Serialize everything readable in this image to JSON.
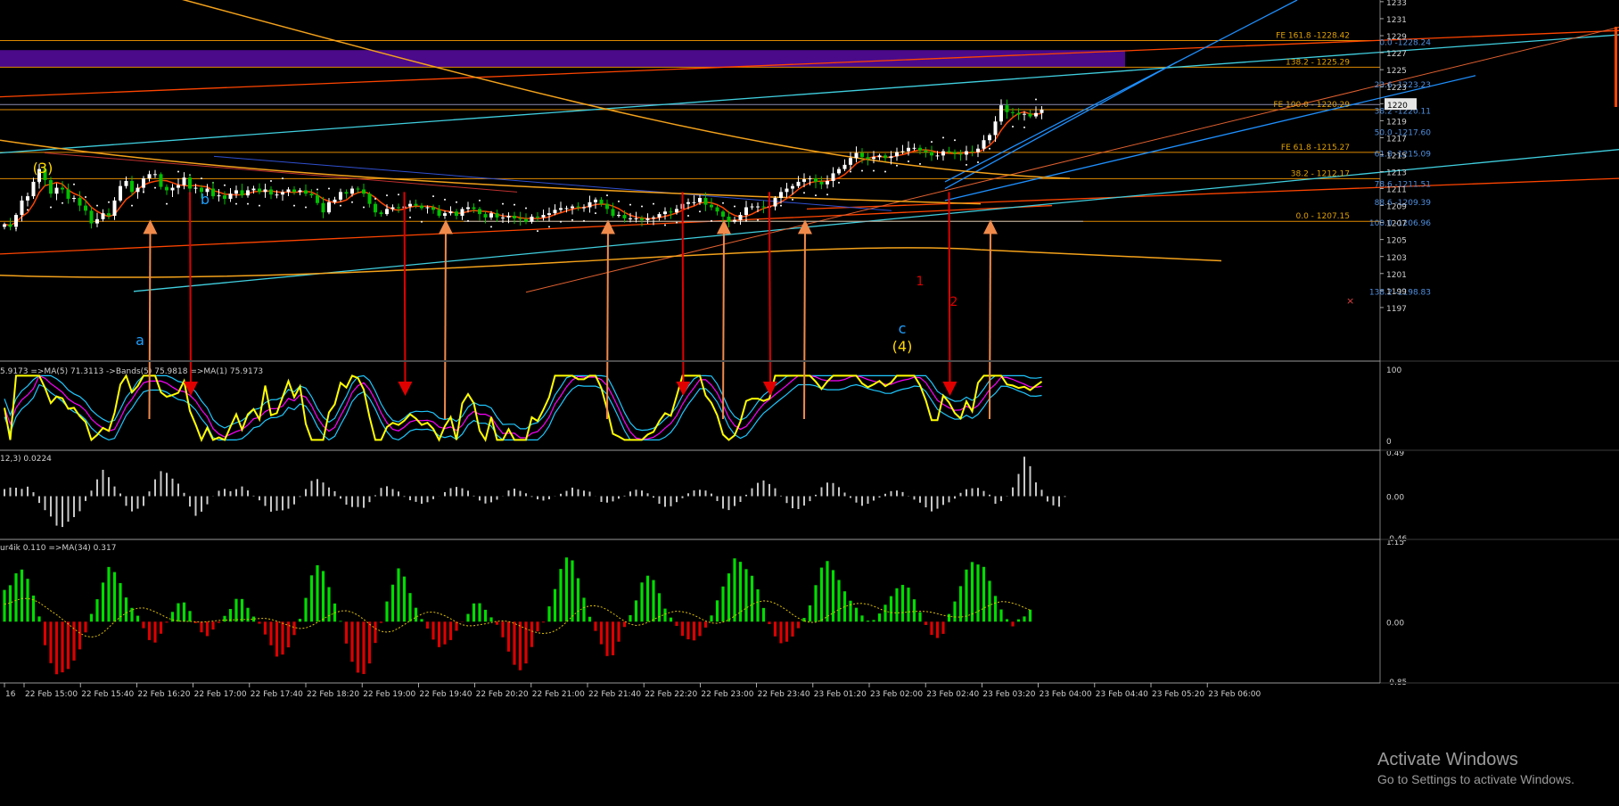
{
  "colors": {
    "background": "#000000",
    "pane_border": "#9a9a9a",
    "axis_text": "#cfcfcf",
    "candle_bull": "#ffffff",
    "candle_bear": "#00c000",
    "ma_fast": "#ff4500",
    "ma_slow": "#f4a21a",
    "psar": "#ffffff",
    "fib_line": "#e08a00",
    "fib_text": "#e0a000",
    "retrace_text": "#4f8fe0",
    "trend_blue": "#1e90ff",
    "trend_cyan": "#40d0e0",
    "trend_orange": "#ff4500",
    "zone": "#4b0a8a",
    "arrow_up": "#f08a4b",
    "arrow_down": "#e00000",
    "stoch_main": "#ffff00",
    "stoch_ma": "#ff00ff",
    "stoch_bands": "#1ec8ff",
    "osc_bar": "#c8c8c8",
    "hist_pos": "#00dd00",
    "hist_neg": "#dd0000",
    "hist_ma": "#e0c000"
  },
  "chart_data": {
    "type": "candlestick",
    "price_axis": {
      "range": [
        1190.8,
        1233.2
      ],
      "tick_labels": [
        "1233",
        "1231",
        "1229",
        "1227",
        "1225",
        "1223",
        "1221",
        "1219",
        "1217",
        "1215",
        "1213",
        "1211",
        "1209",
        "1207",
        "1205",
        "1203",
        "1201",
        "1199",
        "1197"
      ],
      "current_price_label": "1220"
    },
    "time_labels": [
      "16",
      "22 Feb 15:00",
      "22 Feb 15:40",
      "22 Feb 16:20",
      "22 Feb 17:00",
      "22 Feb 17:40",
      "22 Feb 18:20",
      "22 Feb 19:00",
      "22 Feb 19:40",
      "22 Feb 20:20",
      "22 Feb 21:00",
      "22 Feb 21:40",
      "22 Feb 22:20",
      "22 Feb 23:00",
      "22 Feb 23:40",
      "23 Feb 01:20",
      "23 Feb 02:00",
      "23 Feb 02:40",
      "23 Feb 03:20",
      "23 Feb 04:00",
      "23 Feb 04:40",
      "23 Feb 05:20",
      "23 Feb 06:00"
    ],
    "close": [
      1206.8,
      1206.5,
      1207.9,
      1209.6,
      1210.1,
      1211.8,
      1213.3,
      1212.0,
      1210.4,
      1211.1,
      1210.9,
      1209.8,
      1209.9,
      1209.0,
      1208.4,
      1206.9,
      1207.4,
      1208.1,
      1207.8,
      1209.6,
      1211.3,
      1211.9,
      1210.6,
      1211.1,
      1212.2,
      1212.7,
      1212.7,
      1211.2,
      1210.8,
      1211.1,
      1211.4,
      1212.3,
      1211.0,
      1211.1,
      1210.6,
      1211.0,
      1210.1,
      1210.2,
      1209.8,
      1210.4,
      1210.8,
      1210.2,
      1210.8,
      1211.0,
      1210.6,
      1210.9,
      1210.3,
      1210.3,
      1210.6,
      1210.9,
      1210.6,
      1210.8,
      1210.4,
      1210.2,
      1209.3,
      1208.2,
      1209.4,
      1209.7,
      1210.6,
      1210.4,
      1211.0,
      1210.9,
      1210.4,
      1209.2,
      1208.2,
      1208.0,
      1208.6,
      1208.8,
      1208.7,
      1208.9,
      1209.2,
      1209.0,
      1208.7,
      1208.8,
      1208.5,
      1207.8,
      1208.1,
      1208.3,
      1207.8,
      1208.6,
      1208.8,
      1208.6,
      1208.0,
      1207.6,
      1208.1,
      1207.6,
      1207.6,
      1207.8,
      1207.5,
      1207.4,
      1207.1,
      1207.7,
      1207.6,
      1207.9,
      1208.1,
      1208.5,
      1208.7,
      1208.7,
      1208.9,
      1208.8,
      1208.8,
      1209.4,
      1209.7,
      1209.2,
      1208.6,
      1207.8,
      1207.9,
      1207.5,
      1207.5,
      1207.5,
      1207.3,
      1207.5,
      1207.6,
      1208.0,
      1208.3,
      1208.2,
      1208.6,
      1209.2,
      1209.4,
      1209.4,
      1209.9,
      1209.1,
      1208.8,
      1208.3,
      1207.7,
      1207.1,
      1207.3,
      1207.9,
      1208.8,
      1208.9,
      1208.9,
      1208.8,
      1208.9,
      1209.9,
      1210.6,
      1211.0,
      1211.3,
      1211.8,
      1212.1,
      1212.2,
      1211.8,
      1211.5,
      1211.9,
      1212.8,
      1213.3,
      1213.8,
      1214.6,
      1215.2,
      1214.7,
      1214.5,
      1214.7,
      1214.9,
      1214.6,
      1214.8,
      1215.3,
      1215.4,
      1215.8,
      1215.8,
      1215.5,
      1215.3,
      1214.9,
      1214.9,
      1215.4,
      1215.3,
      1215.1,
      1215.0,
      1215.4,
      1215.3,
      1215.7,
      1216.7,
      1217.3,
      1218.9,
      1220.8,
      1220.0,
      1219.9,
      1219.7,
      1219.8,
      1219.5,
      1219.9,
      1220.3
    ],
    "fib_levels": [
      {
        "label": "FE 161.8 -1228.42",
        "price": 1228.42
      },
      {
        "label": "138.2 - 1225.29",
        "price": 1225.29
      },
      {
        "label": "FE 100.0 - 1220.29",
        "price": 1220.29
      },
      {
        "label": "FE 61.8 -1215.27",
        "price": 1215.27
      },
      {
        "label": "38.2 - 1212.17",
        "price": 1212.17
      },
      {
        "label": "0.0 - 1207.15",
        "price": 1207.15
      }
    ],
    "retracements": [
      {
        "label": "0.0 -1228.24",
        "price": 1228.24
      },
      {
        "label": "23.6 -1223.23",
        "price": 1223.23
      },
      {
        "label": "38.2 -1220.11",
        "price": 1220.11
      },
      {
        "label": "50.0 -1217.60",
        "price": 1217.6
      },
      {
        "label": "61.8 -1215.09",
        "price": 1215.09
      },
      {
        "label": "78.6 -1211.51",
        "price": 1211.51
      },
      {
        "label": "88.6 -1209.39",
        "price": 1209.39
      },
      {
        "label": "100.0 -1206.96",
        "price": 1206.96
      },
      {
        "label": "138.2 -1198.83",
        "price": 1198.83
      }
    ],
    "wave_labels": [
      "(3)",
      "b",
      "a",
      "c",
      "(4)",
      "1",
      "2"
    ],
    "stochastic": {
      "header": "5.9173 =>MA(5) 71.3113 ->Bands(5) 75.9818 =>MA(1) 75.9173",
      "tick_labels": [
        "100",
        "0"
      ],
      "range": [
        0,
        100
      ]
    },
    "oscillator": {
      "header": "12,3) 0.0224",
      "tick_labels": [
        "0.49",
        "0.00",
        "-0.46"
      ],
      "range": [
        -0.46,
        0.49
      ],
      "values": [
        0.079,
        0.096,
        0.094,
        0.081,
        0.106,
        0.044,
        -0.075,
        -0.155,
        -0.226,
        -0.327,
        -0.342,
        -0.283,
        -0.232,
        -0.167,
        -0.053,
        0.062,
        0.187,
        0.293,
        0.211,
        0.108,
        0.03,
        -0.107,
        -0.169,
        -0.139,
        -0.108,
        0.053,
        0.187,
        0.278,
        0.259,
        0.195,
        0.139,
        0.037,
        -0.115,
        -0.218,
        -0.172,
        -0.09,
        -0.002,
        0.06,
        0.081,
        0.055,
        0.078,
        0.108,
        0.064,
        0.006,
        -0.046,
        -0.108,
        -0.172,
        -0.161,
        -0.157,
        -0.139,
        -0.091,
        -0.008,
        0.079,
        0.17,
        0.19,
        0.152,
        0.097,
        0.055,
        -0.027,
        -0.094,
        -0.12,
        -0.12,
        -0.129,
        -0.066,
        0.01,
        0.092,
        0.11,
        0.079,
        0.052,
        -0.007,
        -0.045,
        -0.063,
        -0.084,
        -0.067,
        -0.033,
        -0.001,
        0.045,
        0.089,
        0.103,
        0.088,
        0.061,
        0.006,
        -0.048,
        -0.081,
        -0.068,
        -0.039,
        0.002,
        0.063,
        0.084,
        0.059,
        0.032,
        -0.008,
        -0.035,
        -0.049,
        -0.034,
        -0.002,
        0.027,
        0.059,
        0.095,
        0.077,
        0.062,
        0.05,
        0.001,
        -0.064,
        -0.071,
        -0.058,
        -0.028,
        0.006,
        0.052,
        0.072,
        0.063,
        0.032,
        -0.016,
        -0.084,
        -0.118,
        -0.112,
        -0.066,
        -0.022,
        0.032,
        0.064,
        0.071,
        0.063,
        0.029,
        -0.054,
        -0.138,
        -0.154,
        -0.109,
        -0.064,
        0.016,
        0.088,
        0.148,
        0.175,
        0.135,
        0.088,
        0.006,
        -0.076,
        -0.134,
        -0.143,
        -0.104,
        -0.055,
        0.016,
        0.099,
        0.151,
        0.146,
        0.1,
        0.04,
        -0.019,
        -0.071,
        -0.107,
        -0.084,
        -0.049,
        -0.015,
        0.027,
        0.056,
        0.063,
        0.046,
        0.003,
        -0.038,
        -0.072,
        -0.124,
        -0.169,
        -0.139,
        -0.097,
        -0.068,
        -0.027,
        0.037,
        0.077,
        0.088,
        0.092,
        0.058,
        0.017,
        -0.084,
        -0.055,
        -0.003,
        0.098,
        0.247,
        0.438,
        0.333,
        0.153,
        0.071,
        -0.059,
        -0.102,
        -0.117,
        -0.008
      ]
    },
    "histogram": {
      "header": "ur4ik 0.110 =>MA(34) 0.317",
      "tick_labels": [
        "1.15",
        "0.00",
        "-0.85"
      ],
      "range": [
        -0.85,
        1.15
      ],
      "values": [
        0.454,
        0.521,
        0.691,
        0.745,
        0.613,
        0.373,
        0.075,
        -0.336,
        -0.593,
        -0.751,
        -0.724,
        -0.676,
        -0.555,
        -0.396,
        -0.153,
        0.111,
        0.321,
        0.559,
        0.782,
        0.709,
        0.552,
        0.346,
        0.197,
        0.085,
        -0.093,
        -0.263,
        -0.298,
        -0.172,
        -0.014,
        0.14,
        0.264,
        0.275,
        0.153,
        -0.02,
        -0.152,
        -0.206,
        -0.112,
        -0.017,
        0.083,
        0.182,
        0.326,
        0.324,
        0.198,
        0.073,
        -0.029,
        -0.183,
        -0.337,
        -0.499,
        -0.47,
        -0.367,
        -0.191,
        0.041,
        0.34,
        0.662,
        0.807,
        0.724,
        0.494,
        0.26,
        0.01,
        -0.312,
        -0.573,
        -0.728,
        -0.748,
        -0.597,
        -0.304,
        -0.017,
        0.289,
        0.529,
        0.762,
        0.645,
        0.409,
        0.199,
        0.037,
        -0.098,
        -0.256,
        -0.364,
        -0.324,
        -0.263,
        -0.13,
        -0.004,
        0.111,
        0.261,
        0.264,
        0.17,
        0.062,
        -0.044,
        -0.223,
        -0.427,
        -0.616,
        -0.694,
        -0.597,
        -0.362,
        -0.139,
        -0.012,
        0.219,
        0.466,
        0.754,
        0.917,
        0.876,
        0.621,
        0.342,
        0.07,
        -0.132,
        -0.322,
        -0.491,
        -0.48,
        -0.286,
        -0.076,
        0.093,
        0.304,
        0.56,
        0.657,
        0.595,
        0.407,
        0.187,
        0.059,
        -0.061,
        -0.203,
        -0.252,
        -0.268,
        -0.205,
        -0.084,
        0.089,
        0.305,
        0.503,
        0.69,
        0.904,
        0.856,
        0.751,
        0.656,
        0.462,
        0.196,
        -0.035,
        -0.21,
        -0.308,
        -0.286,
        -0.212,
        -0.093,
        0.054,
        0.233,
        0.522,
        0.773,
        0.866,
        0.737,
        0.596,
        0.434,
        0.3,
        0.199,
        0.088,
        0.016,
        0.024,
        0.117,
        0.242,
        0.365,
        0.478,
        0.526,
        0.487,
        0.32,
        0.135,
        -0.047,
        -0.189,
        -0.233,
        -0.174,
        0.11,
        0.289,
        0.508,
        0.745,
        0.852,
        0.817,
        0.783,
        0.584,
        0.368,
        0.175,
        0.036,
        -0.067,
        0.034,
        0.075,
        0.172
      ]
    }
  },
  "watermark": {
    "title": "Activate Windows",
    "subtitle": "Go to Settings to activate Windows."
  }
}
